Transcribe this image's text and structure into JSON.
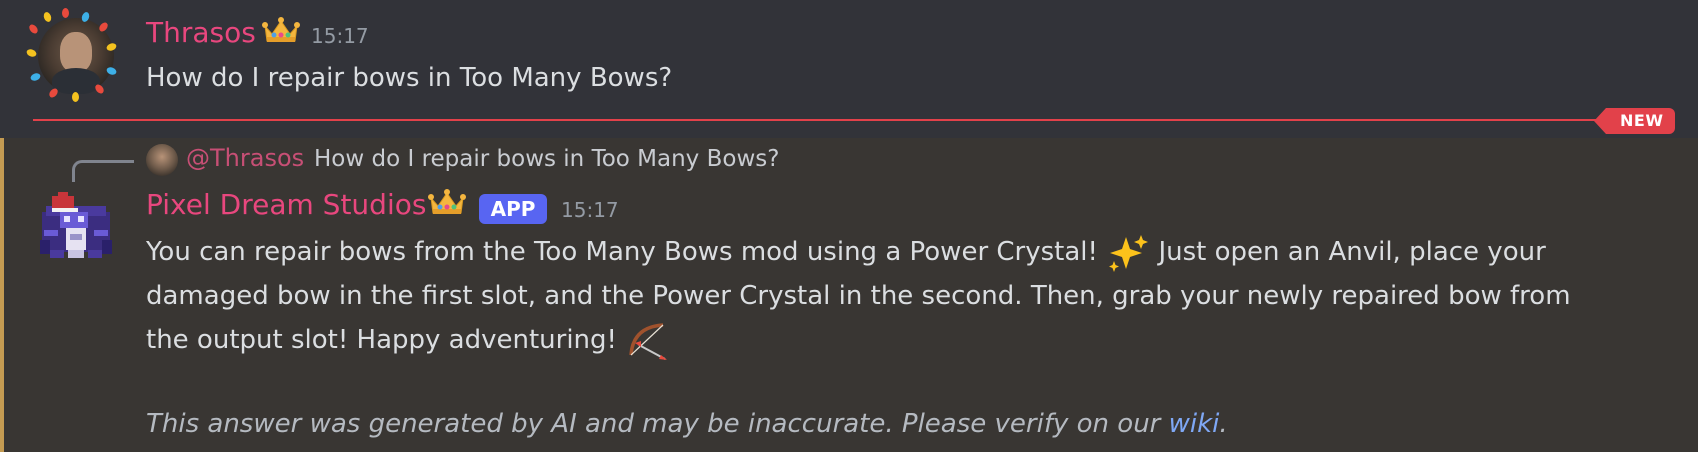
{
  "message1": {
    "username": "Thrasos",
    "badge_icon": "crown-icon",
    "timestamp": "15:17",
    "content": "How do I repair bows in Too Many Bows?"
  },
  "divider": {
    "label": "NEW",
    "color": "#e2414a"
  },
  "message2": {
    "reply": {
      "username": "@Thrasos",
      "content": "How do I repair bows in Too Many Bows?"
    },
    "username": "Pixel Dream Studios",
    "badge_icon": "crown-icon",
    "app_tag": "APP",
    "timestamp": "15:17",
    "line1_part1": "You can repair bows from the Too Many Bows mod using a Power Crystal!",
    "line1_part2": "Just open an Anvil, place your",
    "line2": "damaged bow in the first slot, and the Power Crystal in the second. Then, grab your newly repaired bow from",
    "line3": "the output slot! Happy adventuring!",
    "disclaimer_prefix": "This answer was generated by AI and may be inaccurate. Please verify on our",
    "disclaimer_link": "wiki",
    "disclaimer_suffix": ".",
    "emojis": [
      "sparkles-icon",
      "bow-and-arrow-icon"
    ]
  },
  "colors": {
    "username_color": "#e8477e",
    "app_badge": "#5865f2",
    "highlight_bar": "#c49b52",
    "link": "#7fa8f5"
  }
}
